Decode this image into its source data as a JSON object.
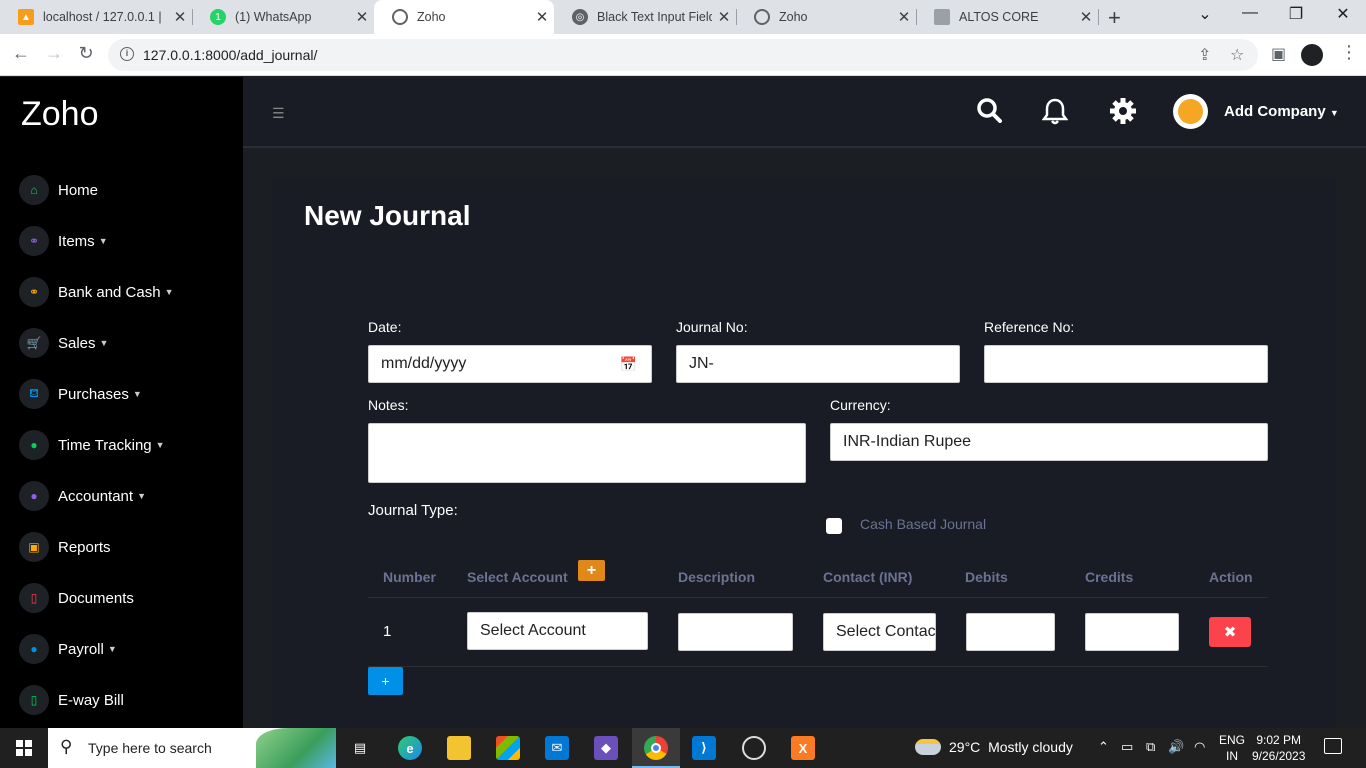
{
  "browser": {
    "tabs": [
      {
        "title": "localhost / 127.0.0.1 |",
        "active": false
      },
      {
        "title": "(1) WhatsApp",
        "active": false
      },
      {
        "title": "Zoho",
        "active": true
      },
      {
        "title": "Black Text Input Field",
        "active": false
      },
      {
        "title": "Zoho",
        "active": false
      },
      {
        "title": "ALTOS CORE",
        "active": false
      }
    ],
    "whatsapp_badge": "1",
    "url": "127.0.0.1:8000/add_journal/"
  },
  "sidebar": {
    "brand": "Zoho",
    "items": [
      {
        "label": "Home",
        "icon": "home-icon",
        "color": "#00d25b",
        "has_dropdown": false
      },
      {
        "label": "Items",
        "icon": "sitemap-icon",
        "color": "#8f5fe8",
        "has_dropdown": true
      },
      {
        "label": "Bank and Cash",
        "icon": "sitemap-icon",
        "color": "#ffab00",
        "has_dropdown": true
      },
      {
        "label": "Sales",
        "icon": "cart-icon",
        "color": "#fc424a",
        "has_dropdown": true
      },
      {
        "label": "Purchases",
        "icon": "basket-icon",
        "color": "#0090e7",
        "has_dropdown": true
      },
      {
        "label": "Time Tracking",
        "icon": "clock-icon",
        "color": "#00d25b",
        "has_dropdown": true
      },
      {
        "label": "Accountant",
        "icon": "user-icon",
        "color": "#8f5fe8",
        "has_dropdown": true
      },
      {
        "label": "Reports",
        "icon": "calendar-icon",
        "color": "#ffab00",
        "has_dropdown": false
      },
      {
        "label": "Documents",
        "icon": "file-icon",
        "color": "#fc424a",
        "has_dropdown": false
      },
      {
        "label": "Payroll",
        "icon": "user-icon",
        "color": "#0090e7",
        "has_dropdown": true
      },
      {
        "label": "E-way Bill",
        "icon": "file-icon",
        "color": "#00d25b",
        "has_dropdown": false
      }
    ]
  },
  "header": {
    "company_label": "Add Company"
  },
  "form": {
    "title": "New Journal",
    "date_label": "Date:",
    "date_placeholder": "mm/dd/yyyy",
    "journal_no_label": "Journal No:",
    "journal_no_value": "JN-",
    "reference_label": "Reference No:",
    "reference_value": "",
    "notes_label": "Notes:",
    "notes_value": "",
    "currency_label": "Currency:",
    "currency_value": "INR-Indian Rupee",
    "journal_type_label": "Journal Type:",
    "cash_based_label": "Cash Based Journal",
    "cash_based_checked": false
  },
  "table": {
    "headers": [
      "Number",
      "Select Account",
      "Description",
      "Contact (INR)",
      "Debits",
      "Credits",
      "Action"
    ],
    "rows": [
      {
        "number": "1",
        "account": "Select Account",
        "description": "",
        "contact": "Select Contact",
        "debits": "",
        "credits": ""
      }
    ],
    "add_row_label": "+",
    "add_account_label": "+",
    "delete_label": "✖"
  },
  "taskbar": {
    "search_placeholder": "Type here to search",
    "weather_temp": "29°C",
    "weather_text": "Mostly cloudy",
    "lang_line1": "ENG",
    "lang_line2": "IN",
    "time": "9:02 PM",
    "date": "9/26/2023"
  }
}
